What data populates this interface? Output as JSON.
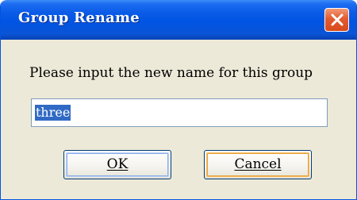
{
  "dialog": {
    "title": "Group Rename",
    "close_icon": "close-icon",
    "prompt": "Please input the new name for this group",
    "input": {
      "value": "three"
    },
    "buttons": {
      "ok_label": "OK",
      "cancel_label": "Cancel"
    }
  },
  "colors": {
    "titlebar": "#0054e3",
    "close_button": "#e35b2f",
    "dialog_background": "#ece9d8",
    "selection": "#316ac5"
  }
}
